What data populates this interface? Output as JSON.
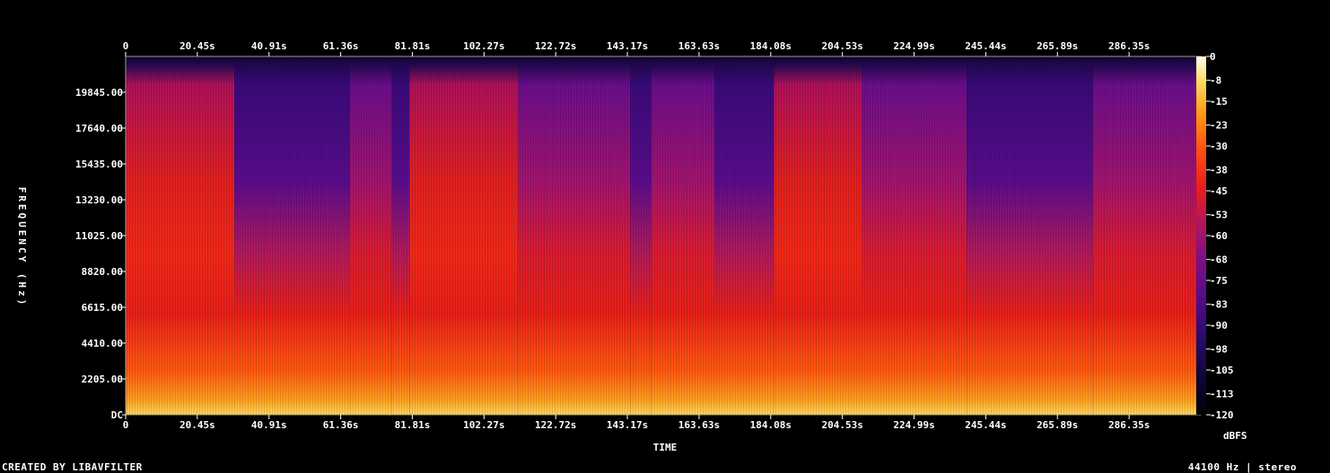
{
  "chart_data": {
    "type": "heatmap",
    "xlabel": "TIME",
    "ylabel": "FREQUENCY (Hz)",
    "x_ticks": [
      "0",
      "20.45s",
      "40.91s",
      "61.36s",
      "81.81s",
      "102.27s",
      "122.72s",
      "143.17s",
      "163.63s",
      "184.08s",
      "204.53s",
      "224.99s",
      "245.44s",
      "265.89s",
      "286.35s"
    ],
    "x_tick_values": [
      0,
      20.45,
      40.91,
      61.36,
      81.81,
      102.27,
      122.72,
      143.17,
      163.63,
      184.08,
      204.53,
      224.99,
      245.44,
      265.89,
      286.35
    ],
    "y_ticks": [
      "DC",
      "2205.00",
      "4410.00",
      "6615.00",
      "8820.00",
      "11025.00",
      "13230.00",
      "15435.00",
      "17640.00",
      "19845.00"
    ],
    "y_tick_values": [
      0,
      2205,
      4410,
      6615,
      8820,
      11025,
      13230,
      15435,
      17640,
      19845
    ],
    "xlim": [
      0,
      306.8
    ],
    "ylim": [
      0,
      22050
    ],
    "colorbar": {
      "label": "dBFS",
      "ticks": [
        "0",
        "-8",
        "-15",
        "-23",
        "-30",
        "-38",
        "-45",
        "-53",
        "-60",
        "-68",
        "-75",
        "-83",
        "-90",
        "-98",
        "-105",
        "-113",
        "-120"
      ],
      "tick_values": [
        0,
        -8,
        -15,
        -23,
        -30,
        -38,
        -45,
        -53,
        -60,
        -68,
        -75,
        -83,
        -90,
        -98,
        -105,
        -113,
        -120
      ],
      "range": [
        -120,
        0
      ],
      "colors": [
        "#000000",
        "#1a0a4e",
        "#4a0a8e",
        "#7a1090",
        "#b01a60",
        "#e0201e",
        "#ff4a10",
        "#ff9a10",
        "#ffd860",
        "#ffffe0"
      ]
    },
    "segments": [
      {
        "start": 0,
        "end": 31,
        "level": 0.8
      },
      {
        "start": 31,
        "end": 64,
        "level": 0.5
      },
      {
        "start": 64,
        "end": 76,
        "level": 0.6
      },
      {
        "start": 76,
        "end": 81,
        "level": 0.2
      },
      {
        "start": 81,
        "end": 112,
        "level": 0.8
      },
      {
        "start": 112,
        "end": 144,
        "level": 0.55
      },
      {
        "start": 144,
        "end": 150,
        "level": 0.45
      },
      {
        "start": 150,
        "end": 168,
        "level": 0.6
      },
      {
        "start": 168,
        "end": 185,
        "level": 0.5
      },
      {
        "start": 185,
        "end": 210,
        "level": 0.9
      },
      {
        "start": 210,
        "end": 240,
        "level": 0.55
      },
      {
        "start": 240,
        "end": 276,
        "level": 0.5
      },
      {
        "start": 276,
        "end": 306.8,
        "level": 0.55
      }
    ]
  },
  "footer": {
    "left": "CREATED BY LIBAVFILTER",
    "right": "44100 Hz | stereo"
  }
}
